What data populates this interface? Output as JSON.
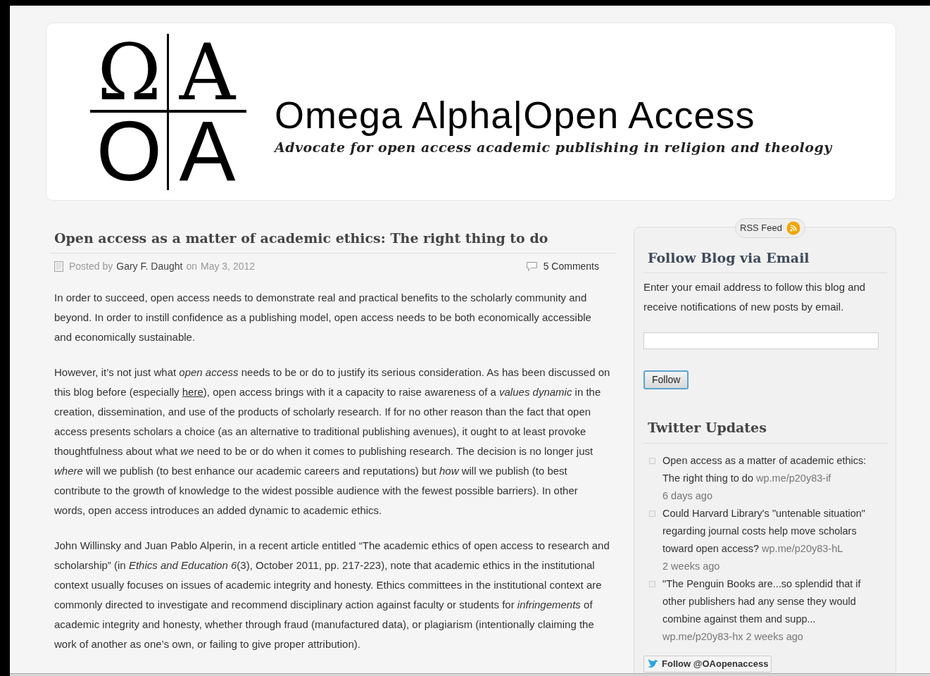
{
  "header": {
    "logo_letters": [
      "Ω",
      "A",
      "O",
      "A"
    ],
    "site_title": "Omega Alpha|Open Access",
    "tagline": "Advocate for open access academic publishing in religion and theology"
  },
  "post": {
    "title": "Open access as a matter of academic ethics: The right thing to do",
    "meta": {
      "prefix": "Posted by",
      "author": "Gary F. Daught",
      "on": "on",
      "date": "May 3, 2012",
      "comments": "5 Comments"
    },
    "paragraphs": [
      {
        "parts": [
          {
            "kind": "text",
            "text": "In order to succeed, open access needs to demonstrate real and practical benefits to the scholarly community and beyond. In order to instill confidence as a publishing model, open access needs to be both economically accessible and economically sustainable."
          }
        ]
      },
      {
        "parts": [
          {
            "kind": "text",
            "text": "However, it’s not just what *open access* needs to be or do to justify its serious consideration. As has been discussed on this blog before (especially "
          },
          {
            "kind": "link",
            "text": "here"
          },
          {
            "kind": "text",
            "text": "), open access brings with it a capacity to raise awareness of a *values dynamic* in the creation, dissemination, and use of the products of scholarly research. If for no other reason than the fact that open access presents scholars a choice (as an alternative to traditional publishing avenues), it ought to at least provoke thoughtfulness about what *we* need to be or do when it comes to publishing research. The decision is no longer just *where* will we publish (to best enhance our academic careers and reputations) but *how* will we publish (to best contribute to the growth of knowledge to the widest possible audience with the fewest possible barriers). In other words, open access introduces an added dynamic to academic ethics."
          }
        ]
      },
      {
        "parts": [
          {
            "kind": "text",
            "text": "John Willinsky and Juan Pablo Alperin, in a recent article entitled “The academic ethics of open access to research and scholarship” (in *Ethics and Education 6*(3), October 2011, pp. 217-223), note that academic ethics in the institutional context usually focuses on issues of academic integrity and honesty. Ethics committees in the institutional context are commonly directed to investigate and recommend disciplinary action against faculty or students for *infringements* of academic integrity and honesty, whether through fraud (manufactured data), or plagiarism (intentionally claiming the work of another as one’s own, or failing to give proper attribution)."
          }
        ]
      }
    ]
  },
  "sidebar": {
    "rss_label": "RSS Feed",
    "email_widget": {
      "title": "Follow Blog via Email",
      "description": "Enter your email address to follow this blog and receive notifications of new posts by email.",
      "button": "Follow"
    },
    "twitter_widget": {
      "title": "Twitter Updates",
      "tweets": [
        {
          "text": "Open access as a matter of academic ethics: The right thing to do",
          "link": "wp.me/p20y83-if",
          "time": "6 days ago"
        },
        {
          "text": "Could Harvard Library's \"untenable situation\" regarding journal costs help move scholars toward open access?",
          "link": "wp.me/p20y83-hL",
          "time": "2 weeks ago"
        },
        {
          "text": "\"The Penguin Books are...so splendid that if other publishers had any sense they would combine against them and supp...",
          "link": "wp.me/p20y83-hx",
          "time": "2 weeks ago"
        }
      ],
      "follow_button": "Follow @OAopenaccess"
    }
  }
}
